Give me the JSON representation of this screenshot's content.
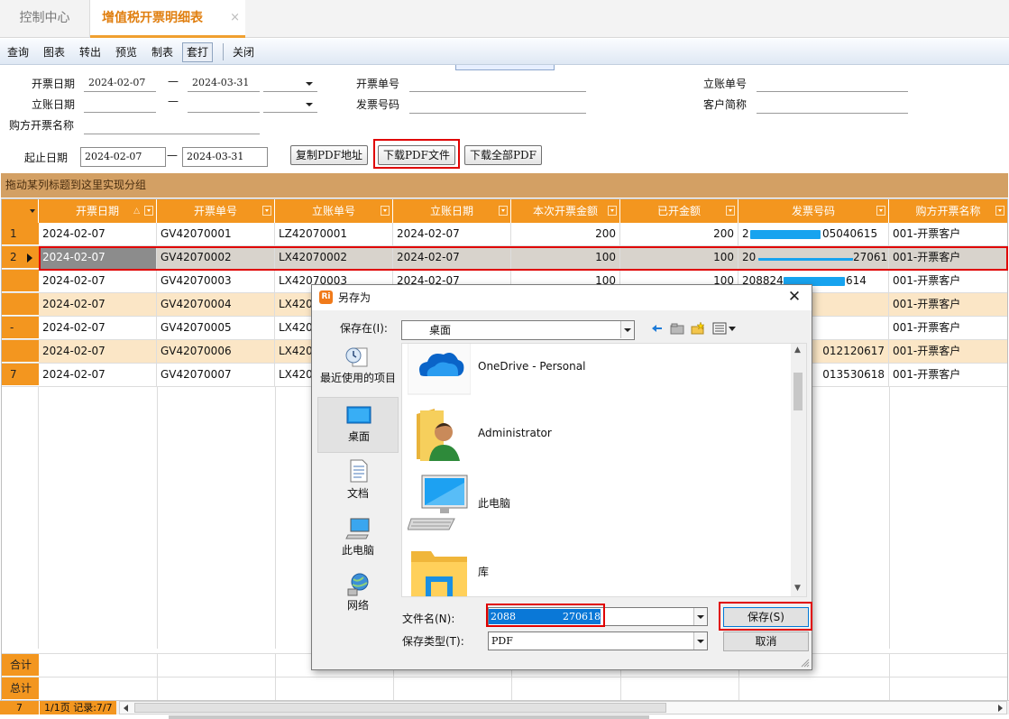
{
  "tabs": [
    {
      "label": "控制中心",
      "active": false
    },
    {
      "label": "增值税开票明细表",
      "active": true,
      "close": "×"
    }
  ],
  "toolbar": {
    "items": [
      "查询",
      "图表",
      "转出",
      "预览",
      "制表",
      "套打",
      "关闭"
    ],
    "active_item": "套打"
  },
  "filters": {
    "invoice_date_label": "开票日期",
    "invoice_date_from": "2024-02-07",
    "invoice_date_to": "2024-03-31",
    "range_sep": "—",
    "account_date_label": "立账日期",
    "buyer_name_label": "购方开票名称",
    "invoice_no_label": "开票单号",
    "invoice_code_label": "发票号码",
    "account_no_label": "立账单号",
    "customer_label": "客户简称",
    "period_label": "起止日期",
    "period_from": "2024-02-07",
    "period_to": "2024-03-31"
  },
  "buttons": {
    "copy_pdf": "复制PDF地址",
    "download_pdf": "下载PDF文件",
    "download_all": "下载全部PDF"
  },
  "grid": {
    "group_hint": "拖动某列标题到这里实现分组",
    "columns": [
      "开票日期",
      "开票单号",
      "立账单号",
      "立账日期",
      "本次开票金额",
      "已开金额",
      "发票号码",
      "购方开票名称"
    ],
    "rows": [
      {
        "ind": "1",
        "date": "2024-02-07",
        "inv_no": "GV42070001",
        "acc_no": "LZ42070001",
        "acc_date": "2024-02-07",
        "amount": "200",
        "paid": "200",
        "code_a": "2",
        "code_b": "05040615",
        "buyer": "001-开票客户"
      },
      {
        "ind": "2",
        "date": "2024-02-07",
        "inv_no": "GV42070002",
        "acc_no": "LX42070002",
        "acc_date": "2024-02-07",
        "amount": "100",
        "paid": "100",
        "code_a": "20",
        "code_b": "270616",
        "buyer": "001-开票客户"
      },
      {
        "ind": "",
        "date": "2024-02-07",
        "inv_no": "GV42070003",
        "acc_no": "LX42070003",
        "acc_date": "2024-02-07",
        "amount": "100",
        "paid": "100",
        "code_a": "208824",
        "code_b": "614",
        "buyer": "001-开票客户"
      },
      {
        "ind": "",
        "date": "2024-02-07",
        "inv_no": "GV42070004",
        "acc_no": "LX4207",
        "acc_date": "",
        "amount": "",
        "paid": "",
        "code_a": "",
        "code_b": "",
        "buyer": "001-开票客户"
      },
      {
        "ind": "-",
        "date": "2024-02-07",
        "inv_no": "GV42070005",
        "acc_no": "LX4207",
        "acc_date": "",
        "amount": "",
        "paid": "",
        "code_a": "",
        "code_b": "",
        "buyer": "001-开票客户"
      },
      {
        "ind": "",
        "date": "2024-02-07",
        "inv_no": "GV42070006",
        "acc_no": "LX4207",
        "acc_date": "",
        "amount": "",
        "paid": "",
        "code_a": "",
        "code_b": "012120617",
        "buyer": "001-开票客户"
      },
      {
        "ind": "7",
        "date": "2024-02-07",
        "inv_no": "GV42070007",
        "acc_no": "LX4207",
        "acc_date": "",
        "amount": "",
        "paid": "",
        "code_a": "",
        "code_b": "013530618",
        "buyer": "001-开票客户"
      }
    ],
    "subtotal_label": "合计",
    "total_label": "总计"
  },
  "status": {
    "count": "7",
    "info": "1/1页 记录:7/7"
  },
  "dialog": {
    "app_icon": "Ri",
    "title": "另存为",
    "save_in_label": "保存在(I):",
    "save_in_value": "桌面",
    "places": [
      "最近使用的项目",
      "桌面",
      "文档",
      "此电脑",
      "网络"
    ],
    "items": [
      "OneDrive - Personal",
      "Administrator",
      "此电脑",
      "库"
    ],
    "filename_label": "文件名(N):",
    "filename_start": "2088",
    "filename_end": "270618",
    "filetype_label": "保存类型(T):",
    "filetype_value": "PDF",
    "save_button": "保存(S)",
    "cancel_button": "取消"
  },
  "colors": {
    "accent_orange": "#f3961f",
    "tab_active": "#e07f10",
    "highlight_red": "#e00000",
    "redaction_blue": "#17a3ef"
  }
}
